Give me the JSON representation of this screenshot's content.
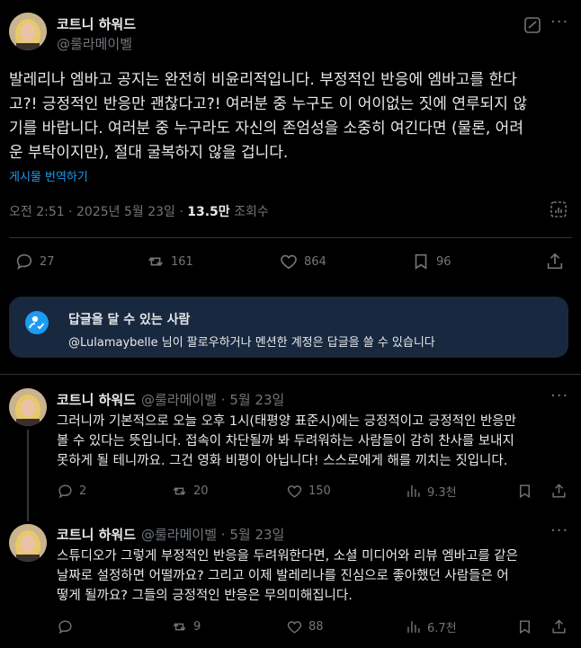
{
  "main_post": {
    "author_name": "코트니 하워드",
    "author_handle": "@룰라메이벨",
    "more": "···",
    "text_lines": [
      "발레리나 엠바고 공지는 완전히 비윤리적입니다. 부정적인 반응에 엠바고를 한다",
      "고?! 긍정적인 반응만 괜찮다고?! 여러분 중 누구도 이 어이없는 짓에 연루되지 않",
      "기를 바랍니다. 여러분 중 누구라도 자신의 존엄성을 소중히 여긴다면 (물론, 어려",
      "운 부탁이지만), 절대 굴복하지 않을 겁니다."
    ],
    "translate_label": "게시물 번역하기",
    "time_date": "오전 2:51 · 2025년 5월 23일 · ",
    "views_count": "13.5만",
    "views_label": " 조회수",
    "replies": "27",
    "reposts": "161",
    "likes": "864",
    "bookmarks": "96"
  },
  "reply_box": {
    "title": "답글을 달 수 있는 사람",
    "subtitle": "@Lulamaybelle 님이 팔로우하거나 멘션한 계정은 답글을 쓸 수 있습니다"
  },
  "replies": [
    {
      "author_name": "코트니 하워드",
      "author_handle": "@룰라메이벨 · 5월 23일",
      "more": "···",
      "text_lines": [
        "그러니까 기본적으로 오늘 오후 1시(태평양 표준시)에는 긍정적이고 긍정적인 반응만",
        "볼 수 있다는 뜻입니다. 접속이 차단될까 봐 두려워하는 사람들이 감히 찬사를 보내지",
        "못하게 될 테니까요. 그건 영화 비평이 아닙니다! 스스로에게 해를 끼치는 짓입니다."
      ],
      "replies": "2",
      "reposts": "20",
      "likes": "150",
      "views": "9.3천"
    },
    {
      "author_name": "코트니 하워드",
      "author_handle": "@룰라메이벨 · 5월 23일",
      "more": "···",
      "text_lines": [
        "스튜디오가 그렇게 부정적인 반응을 두려워한다면, 소셜 미디어와 리뷰 엠바고를 같은",
        "날짜로 설정하면 어떨까요? 그리고 이제 발레리나를 진심으로 좋아했던 사람들은 어",
        "떻게 될까요? 그들의 긍정적인 반응은 무의미해집니다."
      ],
      "replies": "",
      "reposts": "9",
      "likes": "88",
      "views": "6.7천"
    }
  ],
  "colors": {
    "background": "#000000",
    "text": "#e7e9ea",
    "muted": "#71767b",
    "accent": "#1d9bf0",
    "divider": "#2f3336",
    "box": "#18283f"
  },
  "icons": [
    "reply-icon",
    "repost-icon",
    "like-icon",
    "bookmark-icon",
    "share-icon",
    "views-icon",
    "grok-icon",
    "person-check-icon"
  ]
}
